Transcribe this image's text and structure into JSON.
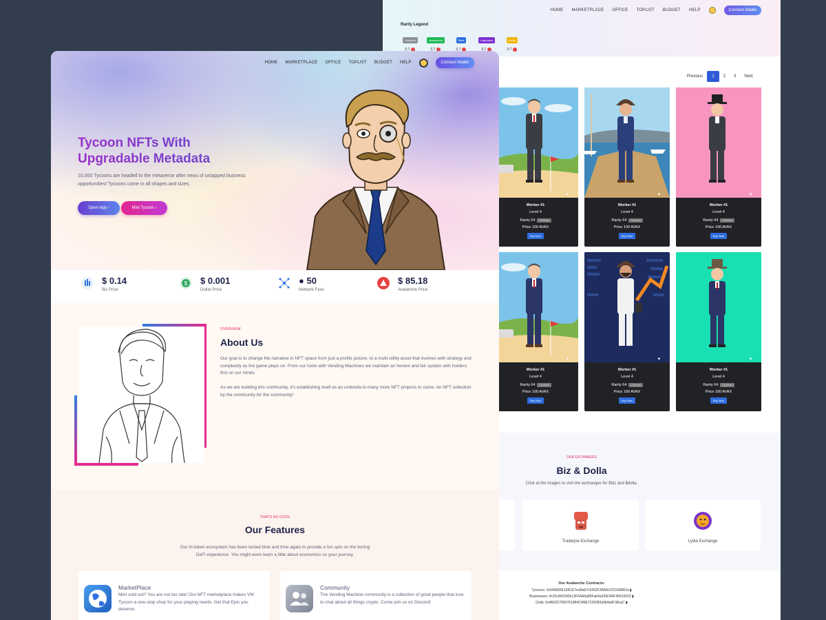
{
  "back": {
    "nav": [
      "HOME",
      "MARKETPLACE",
      "OFFICE",
      "TOPLIST",
      "BUDGET",
      "HELP"
    ],
    "connect_label": "Connect Wallet",
    "rarity": {
      "title": "Rarity Legend",
      "items": [
        {
          "label": "Common",
          "value": "0.7",
          "color": "#8a8f98"
        },
        {
          "label": "Uncommon",
          "value": "0.7",
          "color": "#1db954"
        },
        {
          "label": "Rare",
          "value": "0.7",
          "color": "#2f6fe0"
        },
        {
          "label": "Legendary",
          "value": "0.7",
          "color": "#7b2fd0"
        },
        {
          "label": "Exotic",
          "value": "0.7",
          "color": "#f0b40a"
        }
      ]
    },
    "pager": {
      "prev": "Previous",
      "pages": [
        "1",
        "2",
        "3"
      ],
      "next": "Next"
    },
    "cards": [
      {
        "name": "Worker #1",
        "level": "Level 4",
        "rarity": "Rarity 64",
        "tag": "Common",
        "price": "Price 100 AVAX",
        "buy": "Buy Now",
        "bg": "golf"
      },
      {
        "name": "Worker #1",
        "level": "Level 4",
        "rarity": "Rarity 64",
        "tag": "Common",
        "price": "Price 100 AVAX",
        "buy": "Buy Now",
        "bg": "harbor"
      },
      {
        "name": "Worker #1",
        "level": "Level 4",
        "rarity": "Rarity 64",
        "tag": "Common",
        "price": "Price 100 AVAX",
        "buy": "Buy Now",
        "bg": "pink"
      },
      {
        "name": "Worker #1",
        "level": "Level 4",
        "rarity": "Rarity 64",
        "tag": "Common",
        "price": "Price 100 AVAX",
        "buy": "Buy Now",
        "bg": "golf"
      },
      {
        "name": "Worker #1",
        "level": "Level 4",
        "rarity": "Rarity 64",
        "tag": "Common",
        "price": "Price 100 AVAX",
        "buy": "Buy Now",
        "bg": "stock"
      },
      {
        "name": "Worker #1",
        "level": "Level 4",
        "rarity": "Rarity 64",
        "tag": "Common",
        "price": "Price 100 AVAX",
        "buy": "Buy Now",
        "bg": "teal"
      }
    ],
    "exchanges": {
      "overline": "OUR EXCHANGES",
      "title": "Biz & Dolla",
      "desc": "Click at the images to visit the exchanges for $biz and $dolla.",
      "items": [
        "Traderjoe Exchange",
        "Lydia Exchange"
      ]
    },
    "contracts": {
      "title": "Our Avalanche Contracts:",
      "lines": [
        "Tycoons: 0x549682E166CE7ecBa67c5262F2BA8cCfC0d3881d",
        "Businesses: 0x15c841043e13FFAA0a89Fab6a236D40F45615623",
        "Dolla: 0x4B3227650761984C0f9E7220082a9b4a9F38caC"
      ]
    }
  },
  "front": {
    "nav": [
      "HOME",
      "MARKETPLACE",
      "OFFICE",
      "TOPLIST",
      "BUDGET",
      "HELP"
    ],
    "connect_label": "Connect Wallet",
    "hero": {
      "title": "Tycoon NFTs With Upgradable Metadata",
      "subtitle": "10,000 Tycoons are headed to the metaverse after news of untapped business opportunities! Tycoons come in all shapes and sizes.",
      "open_app": "Open App",
      "mint": "Mint Tycoon"
    },
    "stats": [
      {
        "value": "$ 0.14",
        "label": "Biz Price",
        "icon": "biz-icon"
      },
      {
        "value": "$ 0.001",
        "label": "Dollar Price",
        "icon": "dollar-icon"
      },
      {
        "value": "● 50",
        "label": "Network Fees",
        "icon": "network-icon"
      },
      {
        "value": "$ 85.18",
        "label": "Avalanche Price",
        "icon": "avalanche-icon"
      }
    ],
    "about": {
      "overline": "OVERVIEW",
      "title": "About Us",
      "p1": "Our goal is to change the narrative in NFT space from just a profile picture, to a multi-utility asset that evolves with strategy and complexity as the game plays on. From our roots with Vending Machines we maintain an honest and fair system with holders first on our minds.",
      "p2": "As we are building this community, it's establishing itself as an umbrella to many more NFT projects to come. An NFT collection by the community for the community!"
    },
    "features": {
      "overline": "THATS SO COOL",
      "title": "Our Features",
      "desc": "Our tri-token ecosystem has been tested time and time again to provide a fun spin on the boring DeFi experience. You might even learn a little about economics on your journey.",
      "items": [
        {
          "title": "MarketPlace",
          "desc": "Mint sold out? You are not too late! Our NFT marketplace makes VM Tycoon a one-stop shop for your playing needs. Get that Epic you deserve."
        },
        {
          "title": "Community",
          "desc": "The Vending Machine community is a collection of great people that love to chat about all things crypto. Come join us on Discord!"
        }
      ]
    }
  }
}
